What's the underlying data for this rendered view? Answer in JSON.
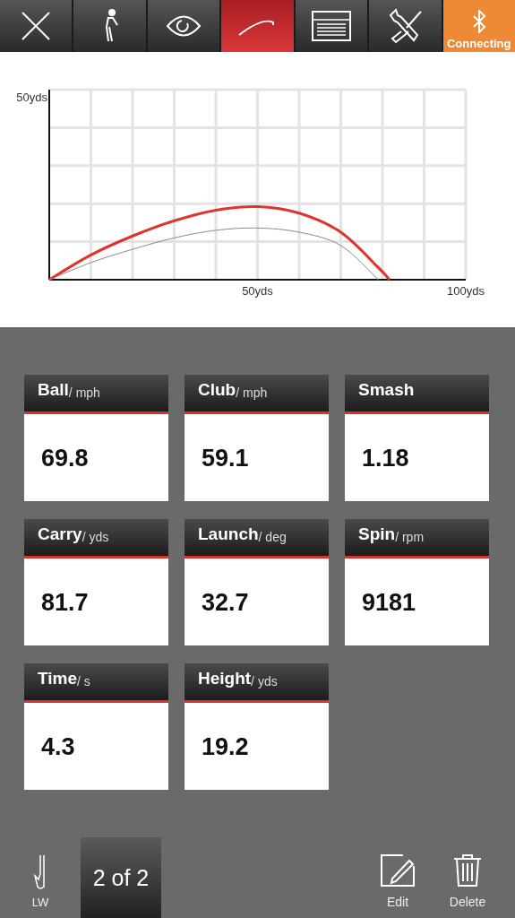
{
  "toolbar": {
    "tabs": [
      {
        "selected": false
      },
      {
        "selected": false
      },
      {
        "selected": false
      },
      {
        "selected": true
      },
      {
        "selected": false
      },
      {
        "selected": false
      }
    ],
    "connection": {
      "label": "Connecting"
    }
  },
  "chart": {
    "y_axis_label": "50yds",
    "x_axis_labels": [
      "50yds",
      "100yds"
    ]
  },
  "metrics": [
    {
      "name": "Ball",
      "unit": "/ mph",
      "value": "69.8"
    },
    {
      "name": "Club",
      "unit": "/ mph",
      "value": "59.1"
    },
    {
      "name": "Smash",
      "value": "1.18"
    },
    {
      "name": "Carry",
      "unit": "/ yds",
      "value": "81.7"
    },
    {
      "name": "Launch",
      "unit": "/ deg",
      "value": "32.7"
    },
    {
      "name": "Spin",
      "unit": "/ rpm",
      "value": "9181"
    },
    {
      "name": "Time",
      "unit": "/ s",
      "value": "4.3"
    },
    {
      "name": "Height",
      "unit": "/ yds",
      "value": "19.2"
    }
  ],
  "bottom_bar": {
    "club": "LW",
    "shot_counter": "2 of 2",
    "actions": [
      {
        "label": "Edit",
        "kind": "edit"
      },
      {
        "label": "Delete",
        "kind": "delete"
      }
    ]
  }
}
